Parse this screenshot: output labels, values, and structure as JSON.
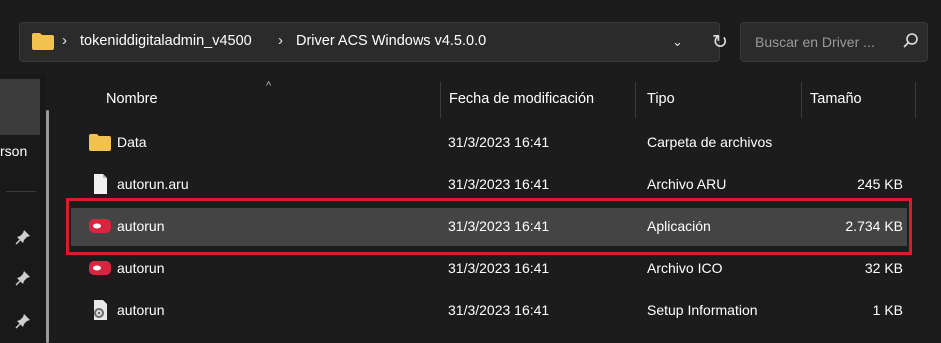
{
  "address_bar": {
    "path": [
      "tokeniddigitaladmin_v4500",
      "Driver ACS Windows v4.5.0.0"
    ]
  },
  "search": {
    "placeholder": "Buscar en Driver ..."
  },
  "nav": {
    "partial_label": "rson"
  },
  "columns": {
    "name": "Nombre",
    "date": "Fecha de modificación",
    "type": "Tipo",
    "size": "Tamaño"
  },
  "files": [
    {
      "name": "Data",
      "date": "31/3/2023 16:41",
      "type": "Carpeta de archivos",
      "size": "",
      "icon": "folder-icon"
    },
    {
      "name": "autorun.aru",
      "date": "31/3/2023 16:41",
      "type": "Archivo ARU",
      "size": "245 KB",
      "icon": "file-icon"
    },
    {
      "name": "autorun",
      "date": "31/3/2023 16:41",
      "type": "Aplicación",
      "size": "2.734 KB",
      "icon": "app-icon",
      "selected": true
    },
    {
      "name": "autorun",
      "date": "31/3/2023 16:41",
      "type": "Archivo ICO",
      "size": "32 KB",
      "icon": "ico-file-icon"
    },
    {
      "name": "autorun",
      "date": "31/3/2023 16:41",
      "type": "Setup Information",
      "size": "1 KB",
      "icon": "setup-info-icon"
    }
  ],
  "colors": {
    "background": "#1c1c1c",
    "selected_row": "#444444",
    "highlight_box": "#d21f2b",
    "folder": "#f2c14e"
  }
}
